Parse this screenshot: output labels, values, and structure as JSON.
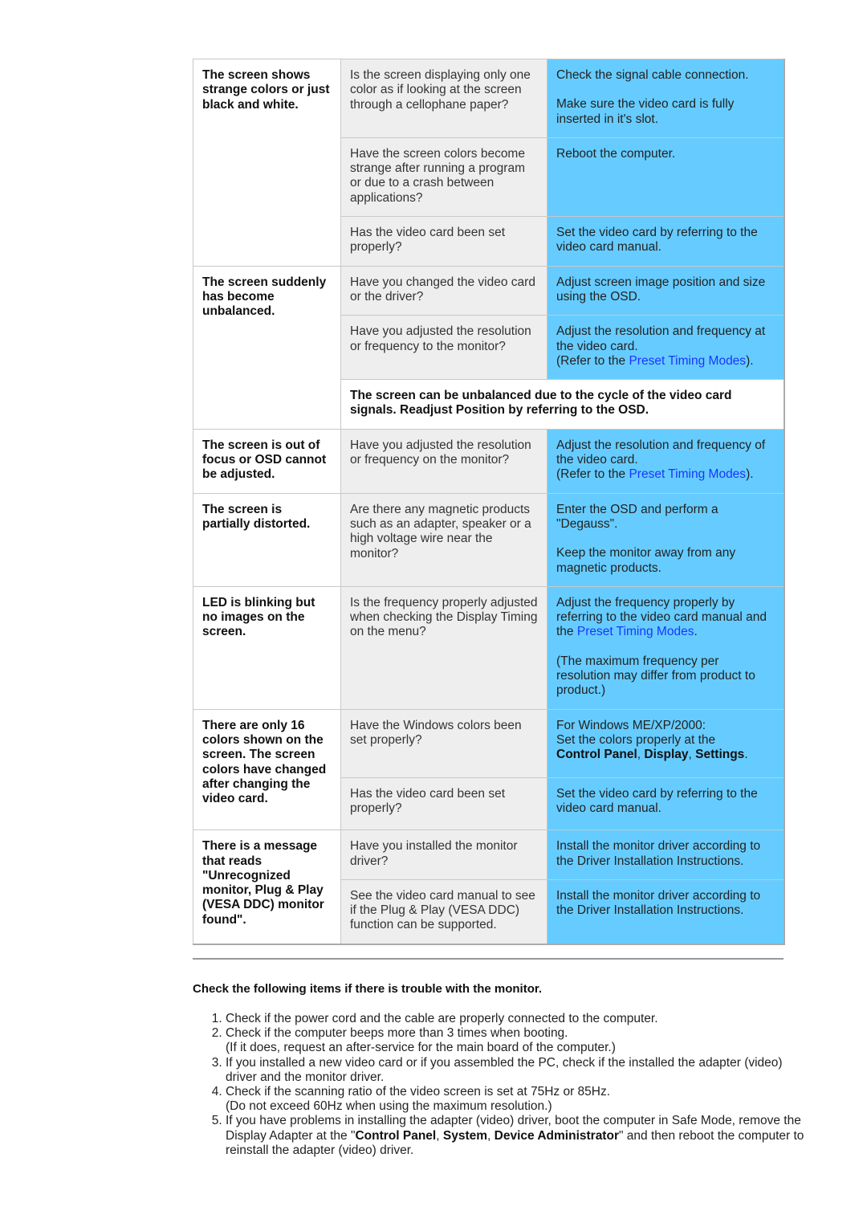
{
  "table": {
    "groups": [
      {
        "symptom": "The screen shows strange colors or just black and white.",
        "rows": [
          {
            "check": "Is the screen displaying only one color as if looking at the screen through a cellophane paper?",
            "solution_parts": [
              "Check the signal cable connection.",
              "Make sure the video card is fully inserted in it's slot."
            ]
          },
          {
            "check": "Have the screen colors become strange after running a program or due to a crash between applications?",
            "solution_parts": [
              "Reboot the computer."
            ]
          },
          {
            "check": "Has the video card been set properly?",
            "solution_parts": [
              "Set the video card by referring to the video card manual."
            ]
          }
        ]
      },
      {
        "symptom": "The screen suddenly has become unbalanced.",
        "rows": [
          {
            "check": "Have you changed the video card or the driver?",
            "solution_parts": [
              "Adjust screen image position and size using the OSD."
            ]
          },
          {
            "check": "Have you adjusted the resolution or frequency to the monitor?",
            "solution_line1": "Adjust the resolution and frequency at the video card.",
            "refer_prefix": "(Refer to the ",
            "link": "Preset Timing Modes",
            "refer_suffix": ")."
          }
        ],
        "note": "The screen can be unbalanced due to the cycle of the video card signals. Readjust Position by referring to the OSD."
      },
      {
        "symptom": "The screen is out of focus or OSD cannot be adjusted.",
        "rows": [
          {
            "check": "Have you adjusted the resolution or frequency on the monitor?",
            "solution_line1": "Adjust the resolution and frequency of the video card.",
            "refer_prefix": "(Refer to the ",
            "link": "Preset Timing Modes",
            "refer_suffix": ")."
          }
        ]
      },
      {
        "symptom": "The screen is partially distorted.",
        "rows": [
          {
            "check": "Are there any magnetic products such as an adapter, speaker or a high voltage wire near the monitor?",
            "solution_parts": [
              "Enter the OSD and perform a \"Degauss\".",
              "Keep the monitor away from any magnetic products."
            ]
          }
        ]
      },
      {
        "symptom": "LED is blinking but no images on the screen.",
        "rows": [
          {
            "check": "Is the frequency properly adjusted when checking the Display Timing on the menu?",
            "solution_line1": "Adjust the frequency properly by referring to the video card manual and the ",
            "link": "Preset Timing Modes",
            "link_suffix": ".",
            "solution_extra": "(The maximum frequency per resolution may differ from product to product.)"
          }
        ]
      },
      {
        "symptom": "There are only 16 colors shown on the screen. The screen colors have changed after changing the video card.",
        "rows": [
          {
            "check": "Have the Windows colors been set properly?",
            "solution_line1": "For Windows ME/XP/2000:",
            "solution_line2": "Set the colors properly at the",
            "bold_items": [
              "Control Panel",
              "Display",
              "Settings"
            ]
          },
          {
            "check": "Has the video card been set properly?",
            "solution_parts": [
              "Set the video card by referring to the video card manual."
            ]
          }
        ]
      },
      {
        "symptom": "There is a message that reads \"Unrecognized monitor, Plug & Play (VESA DDC) monitor found\".",
        "rows": [
          {
            "check": "Have you installed the monitor driver?",
            "solution_parts": [
              "Install the monitor driver according to the Driver Installation Instructions."
            ]
          },
          {
            "check": "See the video card manual to see if the Plug & Play (VESA DDC) function can be supported.",
            "solution_parts": [
              "Install the monitor driver according to the Driver Installation Instructions."
            ]
          }
        ]
      }
    ]
  },
  "checklist": {
    "title": "Check the following items if there is trouble with the monitor.",
    "items": [
      {
        "text": "Check if the power cord and the cable are properly connected to the computer."
      },
      {
        "text": "Check if the computer beeps more than 3 times when booting.",
        "sub": "(If it does, request an after-service for the main board of the computer.)"
      },
      {
        "text": "If you installed a new video card or if you assembled the PC, check if the installed the adapter (video) driver and the monitor driver."
      },
      {
        "text": "Check if the scanning ratio of the video screen is set at 75Hz or 85Hz.",
        "sub": "(Do not exceed 60Hz when using the maximum resolution.)"
      },
      {
        "text_prefix": "If you have problems in installing the adapter (video) driver, boot the computer in Safe Mode, remove the Display Adapter at the \"",
        "bold_items": [
          "Control Panel",
          "System",
          "Device Administrator"
        ],
        "text_suffix": "\" and then reboot the computer to reinstall the adapter (video) driver."
      }
    ]
  }
}
